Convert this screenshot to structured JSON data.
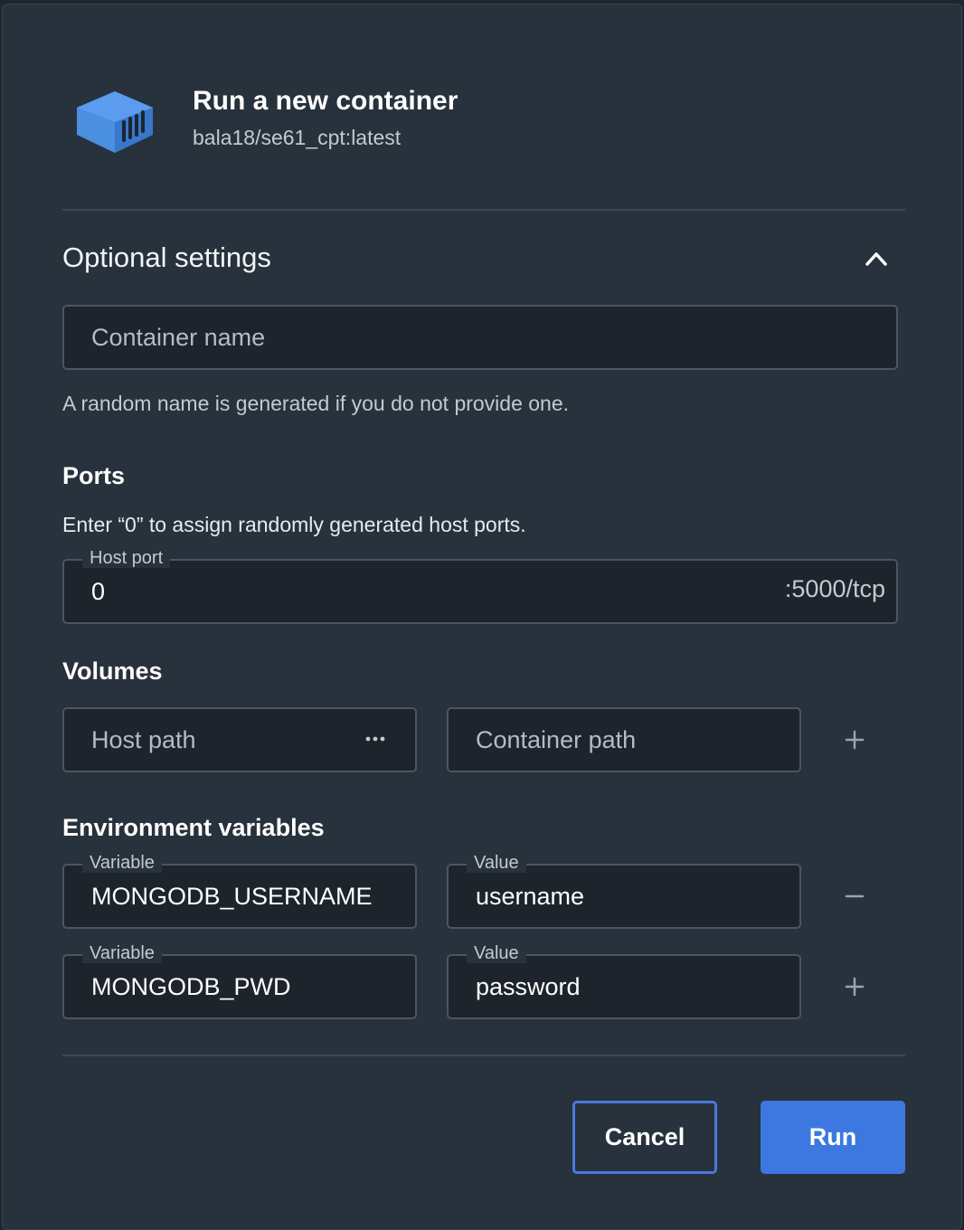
{
  "header": {
    "title": "Run a new container",
    "image_name": "bala18/se61_cpt:latest",
    "icon": "container-icon"
  },
  "optional_settings": {
    "title": "Optional settings",
    "expanded": true,
    "toggle_icon": "chevron-up-icon"
  },
  "container_name": {
    "placeholder": "Container name",
    "value": "",
    "helper": "A random name is generated if you do not provide one."
  },
  "ports": {
    "title": "Ports",
    "description": "Enter “0” to assign randomly generated host ports.",
    "host_port_label": "Host port",
    "host_port_value": "0",
    "container_port": ":5000/tcp"
  },
  "volumes": {
    "title": "Volumes",
    "host_path_placeholder": "Host path",
    "container_path_placeholder": "Container path",
    "browse_icon": "more-horizontal-icon",
    "add_icon": "plus-icon"
  },
  "env": {
    "title": "Environment variables",
    "variable_label": "Variable",
    "value_label": "Value",
    "rows": [
      {
        "variable": "MONGODB_USERNAME",
        "value": "username",
        "action_icon": "minus-icon"
      },
      {
        "variable": "MONGODB_PWD",
        "value": "password",
        "action_icon": "plus-icon"
      }
    ]
  },
  "footer": {
    "cancel_label": "Cancel",
    "run_label": "Run"
  },
  "colors": {
    "background": "#27323c",
    "input_background": "#1e242b",
    "accent": "#3d78e1",
    "icon_blue": "#4a8fe0"
  }
}
